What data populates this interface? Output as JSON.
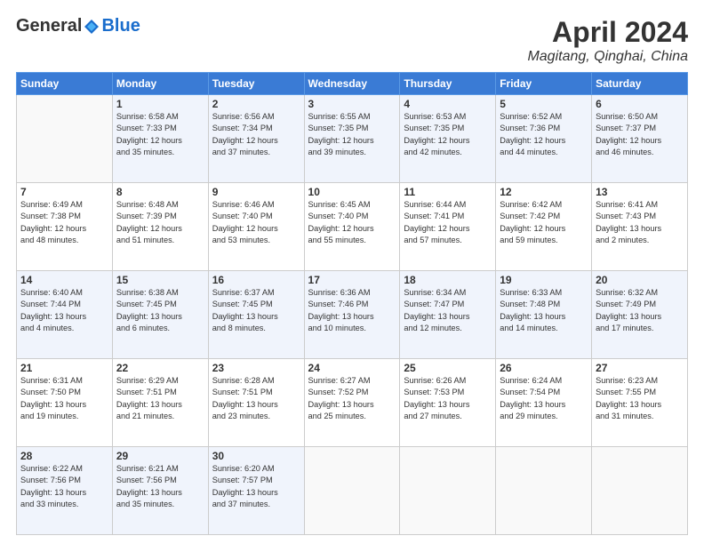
{
  "header": {
    "logo_general": "General",
    "logo_blue": "Blue",
    "title": "April 2024",
    "location": "Magitang, Qinghai, China"
  },
  "days_of_week": [
    "Sunday",
    "Monday",
    "Tuesday",
    "Wednesday",
    "Thursday",
    "Friday",
    "Saturday"
  ],
  "weeks": [
    [
      {
        "day": "",
        "info": ""
      },
      {
        "day": "1",
        "info": "Sunrise: 6:58 AM\nSunset: 7:33 PM\nDaylight: 12 hours\nand 35 minutes."
      },
      {
        "day": "2",
        "info": "Sunrise: 6:56 AM\nSunset: 7:34 PM\nDaylight: 12 hours\nand 37 minutes."
      },
      {
        "day": "3",
        "info": "Sunrise: 6:55 AM\nSunset: 7:35 PM\nDaylight: 12 hours\nand 39 minutes."
      },
      {
        "day": "4",
        "info": "Sunrise: 6:53 AM\nSunset: 7:35 PM\nDaylight: 12 hours\nand 42 minutes."
      },
      {
        "day": "5",
        "info": "Sunrise: 6:52 AM\nSunset: 7:36 PM\nDaylight: 12 hours\nand 44 minutes."
      },
      {
        "day": "6",
        "info": "Sunrise: 6:50 AM\nSunset: 7:37 PM\nDaylight: 12 hours\nand 46 minutes."
      }
    ],
    [
      {
        "day": "7",
        "info": "Sunrise: 6:49 AM\nSunset: 7:38 PM\nDaylight: 12 hours\nand 48 minutes."
      },
      {
        "day": "8",
        "info": "Sunrise: 6:48 AM\nSunset: 7:39 PM\nDaylight: 12 hours\nand 51 minutes."
      },
      {
        "day": "9",
        "info": "Sunrise: 6:46 AM\nSunset: 7:40 PM\nDaylight: 12 hours\nand 53 minutes."
      },
      {
        "day": "10",
        "info": "Sunrise: 6:45 AM\nSunset: 7:40 PM\nDaylight: 12 hours\nand 55 minutes."
      },
      {
        "day": "11",
        "info": "Sunrise: 6:44 AM\nSunset: 7:41 PM\nDaylight: 12 hours\nand 57 minutes."
      },
      {
        "day": "12",
        "info": "Sunrise: 6:42 AM\nSunset: 7:42 PM\nDaylight: 12 hours\nand 59 minutes."
      },
      {
        "day": "13",
        "info": "Sunrise: 6:41 AM\nSunset: 7:43 PM\nDaylight: 13 hours\nand 2 minutes."
      }
    ],
    [
      {
        "day": "14",
        "info": "Sunrise: 6:40 AM\nSunset: 7:44 PM\nDaylight: 13 hours\nand 4 minutes."
      },
      {
        "day": "15",
        "info": "Sunrise: 6:38 AM\nSunset: 7:45 PM\nDaylight: 13 hours\nand 6 minutes."
      },
      {
        "day": "16",
        "info": "Sunrise: 6:37 AM\nSunset: 7:45 PM\nDaylight: 13 hours\nand 8 minutes."
      },
      {
        "day": "17",
        "info": "Sunrise: 6:36 AM\nSunset: 7:46 PM\nDaylight: 13 hours\nand 10 minutes."
      },
      {
        "day": "18",
        "info": "Sunrise: 6:34 AM\nSunset: 7:47 PM\nDaylight: 13 hours\nand 12 minutes."
      },
      {
        "day": "19",
        "info": "Sunrise: 6:33 AM\nSunset: 7:48 PM\nDaylight: 13 hours\nand 14 minutes."
      },
      {
        "day": "20",
        "info": "Sunrise: 6:32 AM\nSunset: 7:49 PM\nDaylight: 13 hours\nand 17 minutes."
      }
    ],
    [
      {
        "day": "21",
        "info": "Sunrise: 6:31 AM\nSunset: 7:50 PM\nDaylight: 13 hours\nand 19 minutes."
      },
      {
        "day": "22",
        "info": "Sunrise: 6:29 AM\nSunset: 7:51 PM\nDaylight: 13 hours\nand 21 minutes."
      },
      {
        "day": "23",
        "info": "Sunrise: 6:28 AM\nSunset: 7:51 PM\nDaylight: 13 hours\nand 23 minutes."
      },
      {
        "day": "24",
        "info": "Sunrise: 6:27 AM\nSunset: 7:52 PM\nDaylight: 13 hours\nand 25 minutes."
      },
      {
        "day": "25",
        "info": "Sunrise: 6:26 AM\nSunset: 7:53 PM\nDaylight: 13 hours\nand 27 minutes."
      },
      {
        "day": "26",
        "info": "Sunrise: 6:24 AM\nSunset: 7:54 PM\nDaylight: 13 hours\nand 29 minutes."
      },
      {
        "day": "27",
        "info": "Sunrise: 6:23 AM\nSunset: 7:55 PM\nDaylight: 13 hours\nand 31 minutes."
      }
    ],
    [
      {
        "day": "28",
        "info": "Sunrise: 6:22 AM\nSunset: 7:56 PM\nDaylight: 13 hours\nand 33 minutes."
      },
      {
        "day": "29",
        "info": "Sunrise: 6:21 AM\nSunset: 7:56 PM\nDaylight: 13 hours\nand 35 minutes."
      },
      {
        "day": "30",
        "info": "Sunrise: 6:20 AM\nSunset: 7:57 PM\nDaylight: 13 hours\nand 37 minutes."
      },
      {
        "day": "",
        "info": ""
      },
      {
        "day": "",
        "info": ""
      },
      {
        "day": "",
        "info": ""
      },
      {
        "day": "",
        "info": ""
      }
    ]
  ]
}
